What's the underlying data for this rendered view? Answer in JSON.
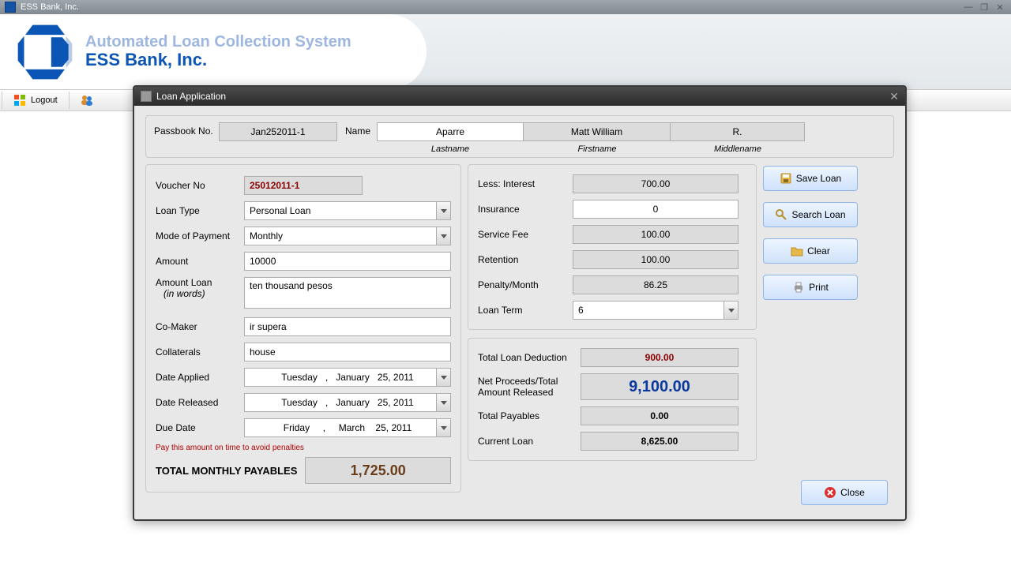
{
  "window": {
    "title": "ESS Bank, Inc."
  },
  "banner": {
    "line1": "Automated Loan Collection System",
    "line2": "ESS Bank, Inc."
  },
  "toolbar": {
    "logout": "Logout"
  },
  "modal": {
    "title": "Loan Application",
    "passbook_label": "Passbook No.",
    "passbook_value": "Jan252011-1",
    "name_label": "Name",
    "lastname": "Aparre",
    "firstname": "Matt William",
    "middlename": "R.",
    "sub_last": "Lastname",
    "sub_first": "Firstname",
    "sub_mid": "Middlename"
  },
  "left": {
    "voucher_label": "Voucher No",
    "voucher_value": "25012011-1",
    "loan_type_label": "Loan Type",
    "loan_type_value": "Personal Loan",
    "mode_label": "Mode of Payment",
    "mode_value": "Monthly",
    "amount_label": "Amount",
    "amount_value": "10000",
    "amount_words_label": "Amount Loan",
    "amount_words_sub": "(in words)",
    "amount_words_value": "ten thousand pesos",
    "comaker_label": "Co-Maker",
    "comaker_value": "ir supera",
    "collaterals_label": "Collaterals",
    "collaterals_value": "house",
    "date_applied_label": "Date Applied",
    "date_applied_value": "Tuesday   ,   January   25, 2011",
    "date_released_label": "Date Released",
    "date_released_value": "Tuesday   ,   January   25, 2011",
    "due_date_label": "Due Date",
    "due_date_value": "Friday     ,     March    25, 2011",
    "warn": "Pay this amount on time to avoid penalties",
    "tmp_label": "TOTAL MONTHLY PAYABLES",
    "tmp_value": "1,725.00"
  },
  "right1": {
    "interest_label": "Less: Interest",
    "interest_value": "700.00",
    "insurance_label": "Insurance",
    "insurance_value": "0",
    "service_label": "Service Fee",
    "service_value": "100.00",
    "retention_label": "Retention",
    "retention_value": "100.00",
    "penalty_label": "Penalty/Month",
    "penalty_value": "86.25",
    "term_label": "Loan Term",
    "term_value": "6"
  },
  "right2": {
    "deduction_label": "Total Loan Deduction",
    "deduction_value": "900.00",
    "net_label1": "Net Proceeds/Total",
    "net_label2": "Amount Released",
    "net_value": "9,100.00",
    "payables_label": "Total Payables",
    "payables_value": "0.00",
    "current_label": "Current Loan",
    "current_value": "8,625.00"
  },
  "buttons": {
    "save": "Save Loan",
    "search": "Search Loan",
    "clear": "Clear",
    "print": "Print",
    "close": "Close"
  }
}
